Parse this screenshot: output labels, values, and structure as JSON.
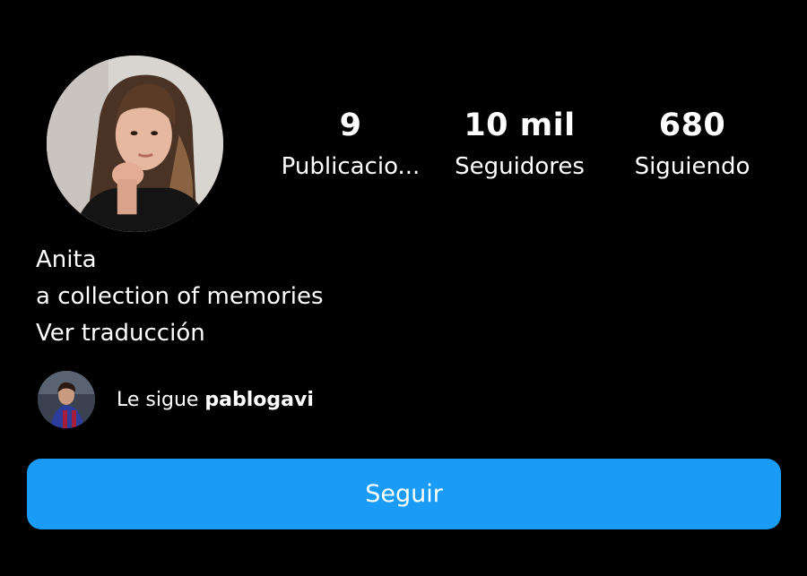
{
  "profile": {
    "avatar_icon": "profile-photo",
    "stats": {
      "posts": {
        "count": "9",
        "label": "Publicacio..."
      },
      "followers": {
        "count": "10 mil",
        "label": "Seguidores"
      },
      "following": {
        "count": "680",
        "label": "Siguiendo"
      }
    },
    "name": "Anita",
    "bio": "a collection of memories",
    "translate_link": "Ver traducción",
    "followed_by": {
      "prefix": "Le sigue",
      "username": "pablogavi"
    },
    "follow_button": "Seguir"
  },
  "colors": {
    "background": "#000000",
    "button": "#1a9bf5",
    "text": "#ffffff"
  }
}
